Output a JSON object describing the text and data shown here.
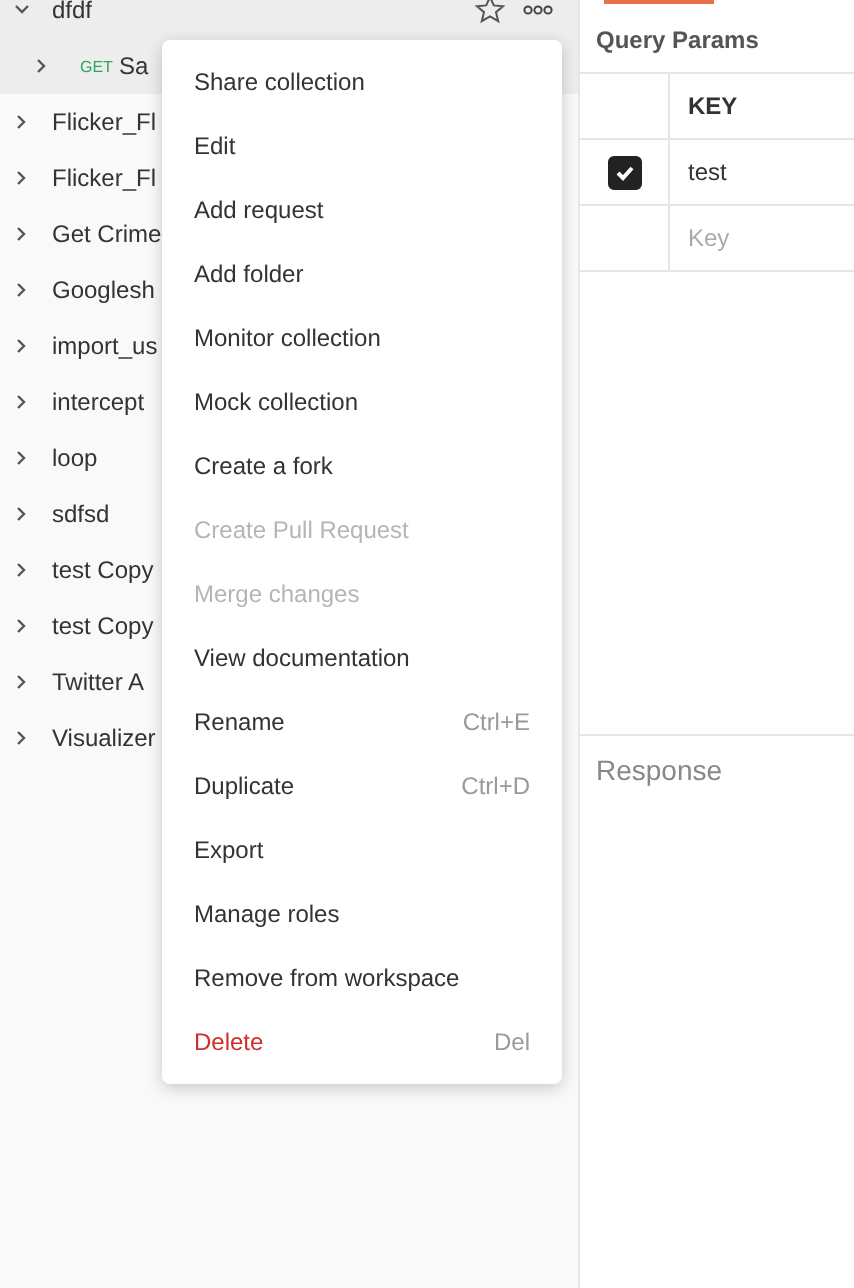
{
  "sidebar": {
    "collections": [
      {
        "name": "dfdf",
        "expanded": true,
        "starred": false,
        "children": [
          {
            "method": "GET",
            "name": "Sa"
          }
        ]
      },
      {
        "name": "Flicker_Fl",
        "expanded": false
      },
      {
        "name": "Flicker_Fl",
        "expanded": false
      },
      {
        "name": "Get Crime",
        "expanded": false
      },
      {
        "name": "Googlesh",
        "expanded": false
      },
      {
        "name": "import_us",
        "expanded": false
      },
      {
        "name": "intercept",
        "expanded": false
      },
      {
        "name": "loop",
        "expanded": false
      },
      {
        "name": "sdfsd",
        "expanded": false
      },
      {
        "name": "test Copy",
        "expanded": false
      },
      {
        "name": "test Copy",
        "expanded": false
      },
      {
        "name": "Twitter A",
        "expanded": false
      },
      {
        "name": "Visualizer",
        "expanded": false
      }
    ]
  },
  "context_menu": {
    "items": [
      {
        "label": "Share collection",
        "disabled": false
      },
      {
        "label": "Edit",
        "disabled": false
      },
      {
        "label": "Add request",
        "disabled": false
      },
      {
        "label": "Add folder",
        "disabled": false
      },
      {
        "label": "Monitor collection",
        "disabled": false
      },
      {
        "label": "Mock collection",
        "disabled": false
      },
      {
        "label": "Create a fork",
        "disabled": false
      },
      {
        "label": "Create Pull Request",
        "disabled": true
      },
      {
        "label": "Merge changes",
        "disabled": true
      },
      {
        "label": "View documentation",
        "disabled": false
      },
      {
        "label": "Rename",
        "shortcut": "Ctrl+E",
        "disabled": false
      },
      {
        "label": "Duplicate",
        "shortcut": "Ctrl+D",
        "disabled": false
      },
      {
        "label": "Export",
        "disabled": false
      },
      {
        "label": "Manage roles",
        "disabled": false
      },
      {
        "label": "Remove from workspace",
        "disabled": false
      },
      {
        "label": "Delete",
        "shortcut": "Del",
        "kind": "danger",
        "disabled": false
      }
    ]
  },
  "request": {
    "section_title": "Query Params",
    "params": {
      "columns": [
        "KEY"
      ],
      "rows": [
        {
          "key": "test",
          "checked": true
        }
      ],
      "placeholder": "Key"
    }
  },
  "response": {
    "title": "Response"
  }
}
